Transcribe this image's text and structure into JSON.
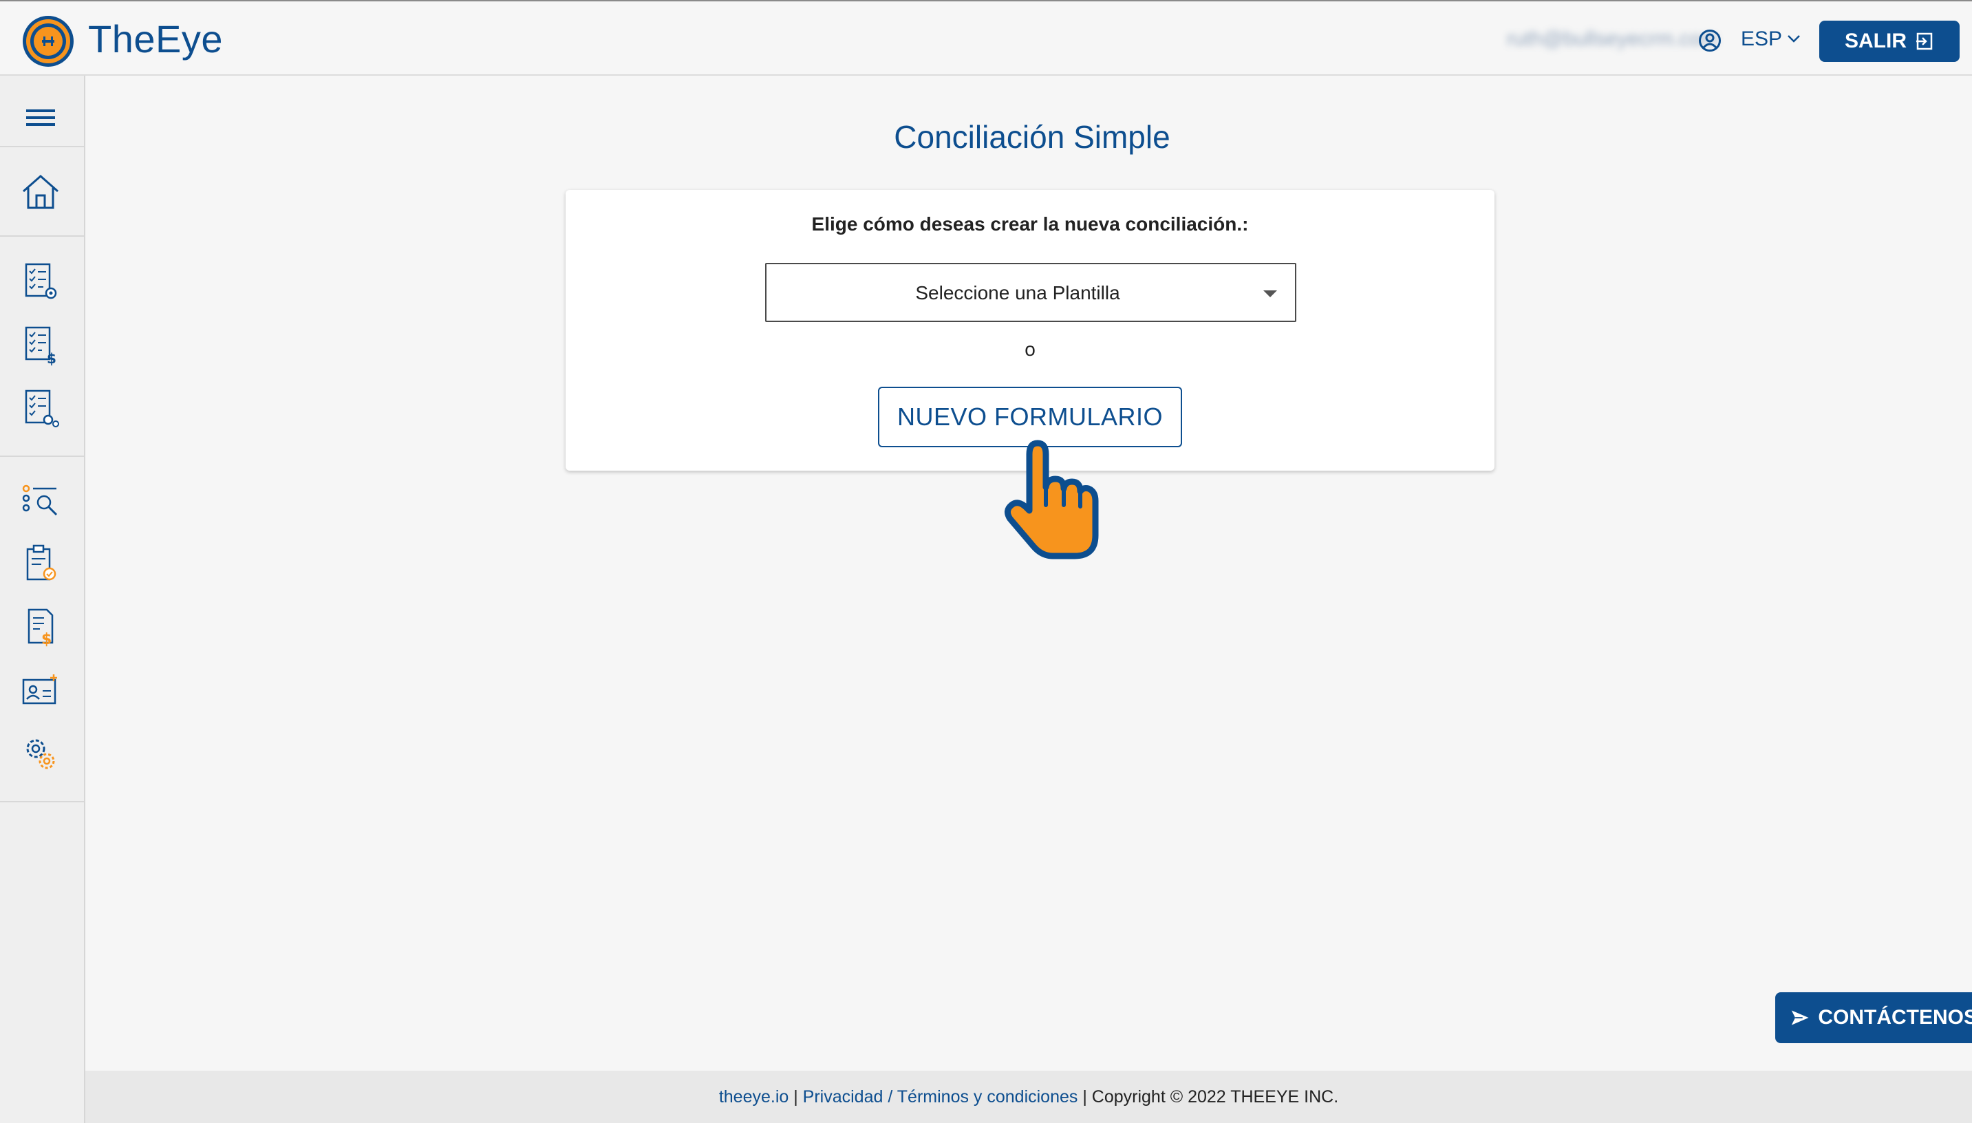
{
  "header": {
    "brand": "TheEye",
    "user_email": "ruth@bullseyecrm.com",
    "language": "ESP",
    "logout_label": "SALIR"
  },
  "sidebar": {
    "items": [
      {
        "icon": "menu-icon"
      },
      {
        "icon": "home-icon"
      },
      {
        "icon": "checklist-settings-icon"
      },
      {
        "icon": "checklist-dollar-icon"
      },
      {
        "icon": "checklist-gears-icon"
      },
      {
        "icon": "search-list-icon"
      },
      {
        "icon": "clipboard-check-icon"
      },
      {
        "icon": "document-dollar-icon"
      },
      {
        "icon": "user-card-icon"
      },
      {
        "icon": "settings-gears-icon"
      }
    ]
  },
  "main": {
    "title": "Conciliación Simple",
    "prompt": "Elige cómo deseas crear la nueva conciliación.:",
    "template_select": {
      "selected": "Seleccione una Plantilla"
    },
    "or_text": "o",
    "new_form_label": "NUEVO FORMULARIO"
  },
  "contact_label": "CONTÁCTENOS",
  "footer": {
    "site": "theeye.io",
    "sep1": " | ",
    "privacy": "Privacidad / Términos y condiciones",
    "copyright": " | Copyright © 2022 THEEYE INC."
  },
  "colors": {
    "primary": "#0d4e8f",
    "accent": "#f7941d",
    "background": "#f6f6f6"
  }
}
